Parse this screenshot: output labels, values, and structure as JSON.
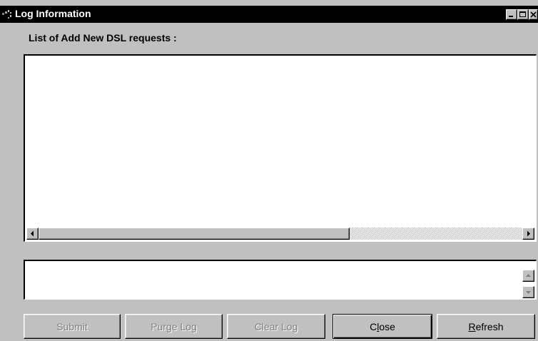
{
  "window": {
    "title": "Log Information",
    "controls": {
      "minimize_icon": "minimize-icon",
      "maximize_icon": "maximize-icon",
      "close_icon": "close-icon"
    }
  },
  "list": {
    "label": "List of Add New DSL requests :",
    "items": []
  },
  "message_box": {
    "value": ""
  },
  "buttons": {
    "submit": {
      "label": "Submit",
      "enabled": false
    },
    "purge_log": {
      "label": "Purge Log",
      "enabled": false
    },
    "clear_log": {
      "label": "Clear Log",
      "enabled": false
    },
    "close": {
      "label_pre": "C",
      "label_ul": "l",
      "label_post": "ose",
      "enabled": true,
      "default": true
    },
    "refresh": {
      "label_pre": "",
      "label_ul": "R",
      "label_post": "efresh",
      "enabled": true
    }
  },
  "colors": {
    "face": "#c0c0c0",
    "titlebar": "#000000",
    "field": "#ffffff",
    "disabled_text": "#808080"
  }
}
